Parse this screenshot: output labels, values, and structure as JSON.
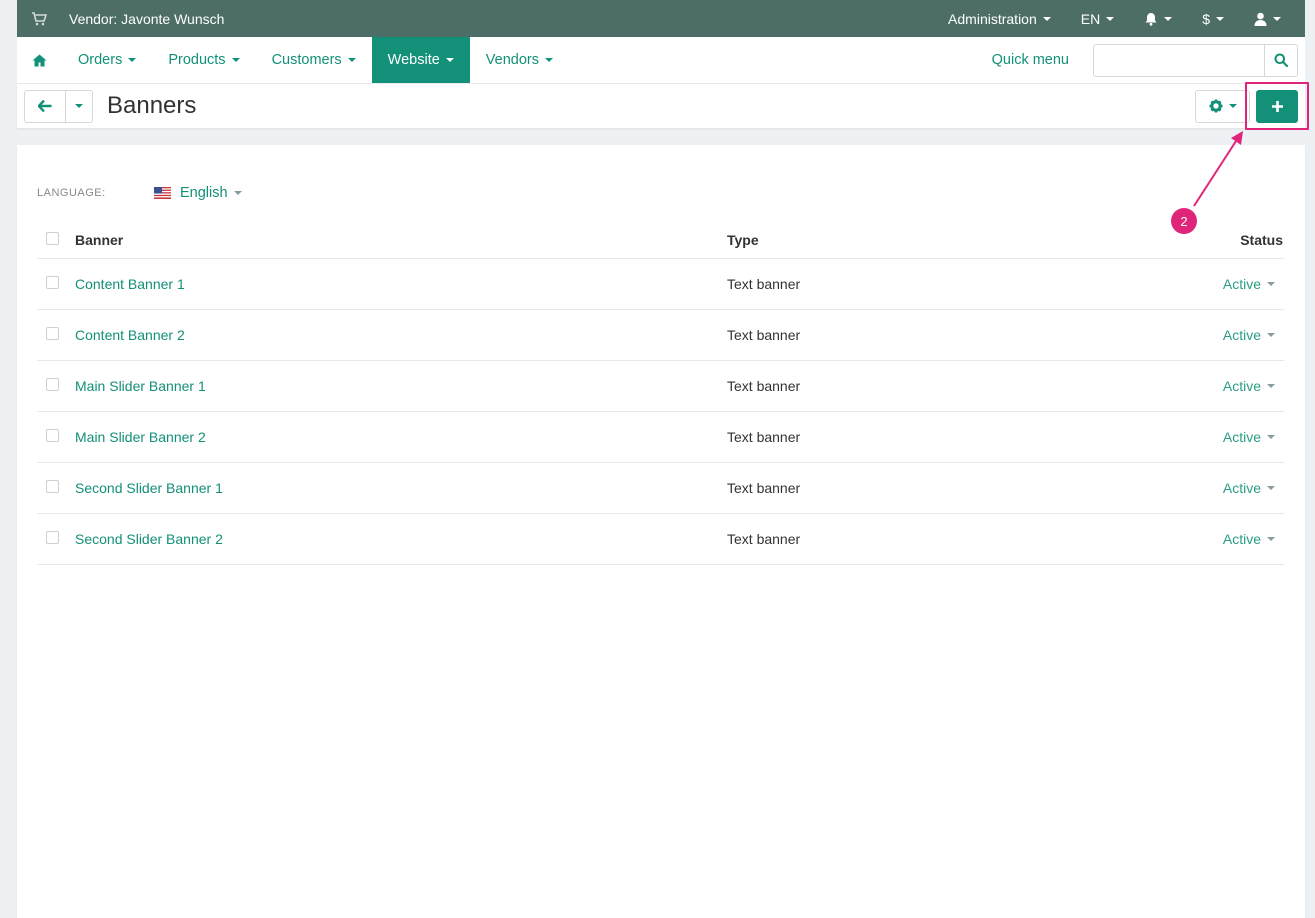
{
  "topbar": {
    "vendor_label": "Vendor: Javonte Wunsch",
    "administration": "Administration",
    "language": "EN",
    "currency": "$"
  },
  "nav": {
    "items": [
      "Orders",
      "Products",
      "Customers",
      "Website",
      "Vendors"
    ],
    "active": "Website",
    "quick_menu": "Quick menu",
    "search_placeholder": ""
  },
  "page": {
    "title": "Banners"
  },
  "content": {
    "language_label": "LANGUAGE:",
    "language_value": "English",
    "columns": {
      "banner": "Banner",
      "type": "Type",
      "status": "Status"
    },
    "rows": [
      {
        "name": "Content Banner 1",
        "type": "Text banner",
        "status": "Active"
      },
      {
        "name": "Content Banner 2",
        "type": "Text banner",
        "status": "Active"
      },
      {
        "name": "Main Slider Banner 1",
        "type": "Text banner",
        "status": "Active"
      },
      {
        "name": "Main Slider Banner 2",
        "type": "Text banner",
        "status": "Active"
      },
      {
        "name": "Second Slider Banner 1",
        "type": "Text banner",
        "status": "Active"
      },
      {
        "name": "Second Slider Banner 2",
        "type": "Text banner",
        "status": "Active"
      }
    ]
  },
  "annotation": {
    "step_number": "2",
    "color": "#e0247a"
  },
  "colors": {
    "topbar_bg": "#4c6e66",
    "accent": "#139078",
    "page_bg": "#eef1f4"
  },
  "icons": {
    "topbar": [
      "cart-icon",
      "bell-icon",
      "user-icon"
    ],
    "nav": [
      "home-icon",
      "search-icon"
    ],
    "title": [
      "arrow-left-icon",
      "gear-icon",
      "plus-icon"
    ],
    "language": "us-flag-icon"
  }
}
